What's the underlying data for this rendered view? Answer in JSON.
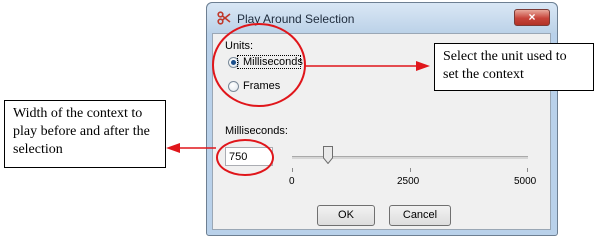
{
  "dialog": {
    "title": "Play Around Selection",
    "close_glyph": "×",
    "units_label": "Units:",
    "options": [
      {
        "label": "Milliseconds",
        "checked": true
      },
      {
        "label": "Frames",
        "checked": false
      }
    ],
    "ms_label": "Milliseconds:",
    "ms_value": "750",
    "slider": {
      "min": 0,
      "max": 5000,
      "value": 750,
      "ticks": [
        "0",
        "2500",
        "5000"
      ]
    },
    "ok_label": "OK",
    "cancel_label": "Cancel"
  },
  "annotations": {
    "unit_note": "Select the unit used to set the context",
    "width_note": "Width of the context to play before and after the selection"
  },
  "colors": {
    "annotation": "#e0161b",
    "titlebar": "#b9d1ea"
  },
  "icons": {
    "app": "scissors-icon",
    "close": "close-icon",
    "thumb": "slider-thumb"
  }
}
